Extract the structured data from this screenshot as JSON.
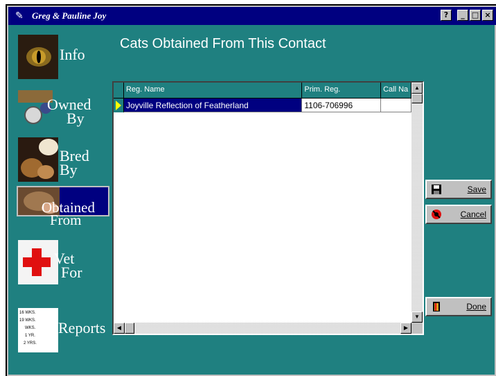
{
  "window": {
    "title": "Greg & Pauline Joy",
    "controls": [
      "?",
      "_",
      "□",
      "×"
    ]
  },
  "heading": "Cats Obtained From This Contact",
  "nav": [
    {
      "label": "Info"
    },
    {
      "label_line1": "Owned",
      "label_line2": "By"
    },
    {
      "label_line1": "Bred",
      "label_line2": "By"
    },
    {
      "label_line1": "Obtained",
      "label_line2": "From",
      "active": true
    },
    {
      "label_line1": "Vet",
      "label_line2": "For"
    },
    {
      "label": "Reports",
      "icon_text": [
        "16 WKS.",
        "19 WKS.",
        "WKS.",
        "1 YR.",
        "2 YRS."
      ]
    }
  ],
  "grid": {
    "columns": [
      "Reg. Name",
      "Prim. Reg.",
      "Call Na"
    ],
    "rows": [
      {
        "reg_name": "Joyville Reflection of Featherland",
        "prim_reg": "1106-706996",
        "call_name": ""
      }
    ]
  },
  "buttons": {
    "save": "Save",
    "cancel": "Cancel",
    "done": "Done"
  },
  "colors": {
    "background": "#1f8080",
    "titlebar": "#000080",
    "selection": "#000080",
    "row_pointer": "#ffff00"
  }
}
